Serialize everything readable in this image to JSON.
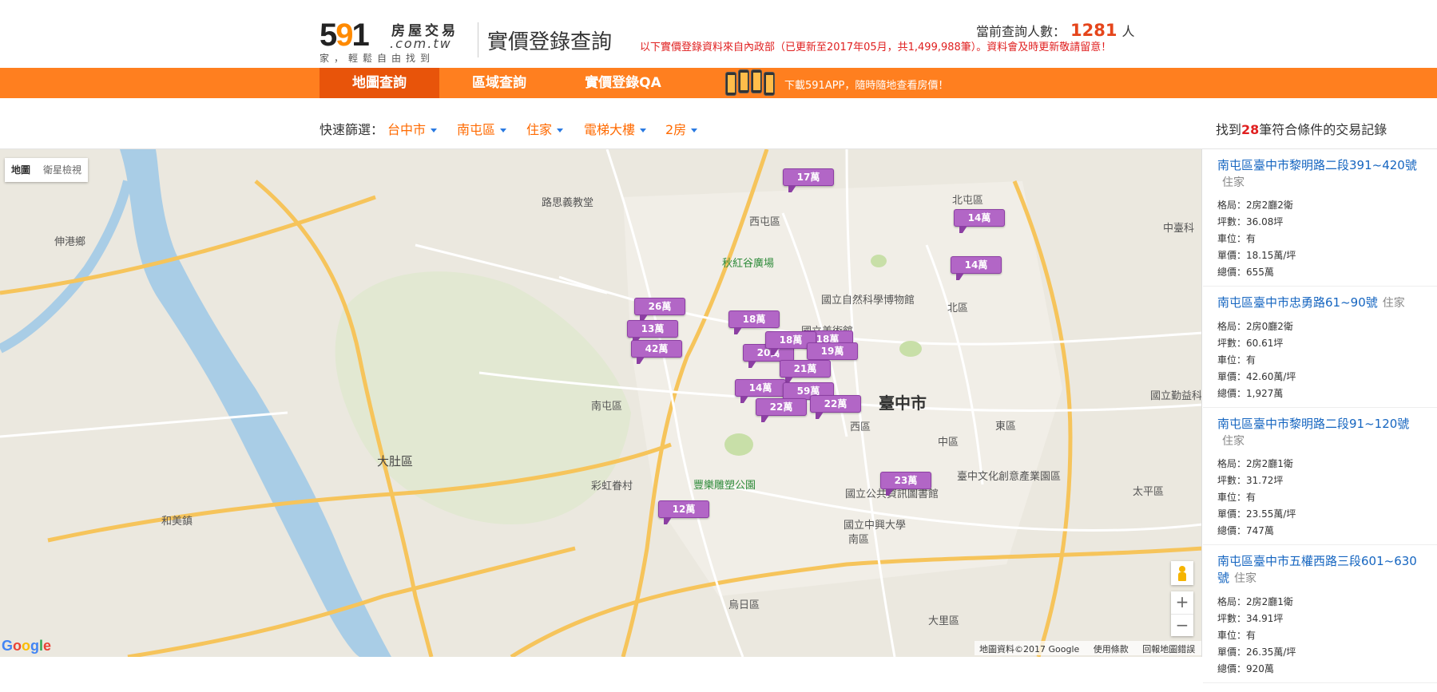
{
  "header": {
    "logo_digits_a": "5",
    "logo_digits_b": "9",
    "logo_digits_c": "1",
    "logo_cn": "房屋交易",
    "logo_domain": ".com.tw",
    "logo_slogan": "家，輕鬆自由找到",
    "site_title": "實價登錄查詢",
    "visitors_label": "當前查詢人數：",
    "visitors_count": "1281",
    "visitors_unit": "人",
    "notice": "以下實價登錄資料來自內政部（已更新至2017年05月，共1,499,988筆）。資料會及時更新敬請留意！"
  },
  "nav": {
    "items": [
      {
        "label": "地圖查詢",
        "active": true
      },
      {
        "label": "區域查詢",
        "active": false
      },
      {
        "label": "實價登錄QA",
        "active": false
      }
    ],
    "promo": "下載591APP，隨時隨地查看房價！"
  },
  "filters": {
    "label": "快速篩選：",
    "city": "台中市",
    "district": "南屯區",
    "usage": "住家",
    "building": "電梯大樓",
    "rooms": "2房",
    "result_prefix": "找到",
    "result_count": "28",
    "result_suffix": "筆符合條件的交易記錄"
  },
  "map": {
    "type_map": "地圖",
    "type_satellite": "衛星檢視",
    "google": "Google",
    "attribution": {
      "data": "地圖資料©2017 Google",
      "terms": "使用條款",
      "report": "回報地圖錯誤"
    },
    "zoom_in": "+",
    "zoom_out": "−",
    "labels": {
      "taichung": "臺中市",
      "dadu": "大肚區",
      "nantun": "南屯區",
      "xitun": "西屯區",
      "beitun": "北屯區",
      "north": "北區",
      "west": "西區",
      "central": "中區",
      "east": "東區",
      "south": "南區",
      "wuri": "烏日區",
      "dali": "大里區",
      "taiping": "太平區",
      "shengang": "伸港鄉",
      "hemei": "和美鎮",
      "luce_chapel": "路思義教堂",
      "qiuhong_park": "秋紅谷廣場",
      "science_museum": "國立自然科學博物館",
      "fine_arts": "國立美術館",
      "fengle_park": "豐樂雕塑公園",
      "caihong_village": "彩虹眷村",
      "public_library": "國立公共資訊圖書館",
      "chunghsing_univ": "國立中興大學",
      "cultural_park": "臺中文化創意產業園區",
      "qinyi_univ": "國立勤益科技大學",
      "zhongshe": "中臺科"
    },
    "pins": [
      "17萬",
      "14萬",
      "14萬",
      "26萬",
      "13萬",
      "42萬",
      "18萬",
      "18萬",
      "20萬",
      "18萬",
      "19萬",
      "21萬",
      "14萬",
      "59萬",
      "22萬",
      "22萬",
      "23萬",
      "12萬"
    ]
  },
  "listings": [
    {
      "title": "南屯區臺中市黎明路二段391~420號",
      "type": "住家",
      "layout": "格局：2房2廳2衛",
      "area": "坪數：36.08坪",
      "parking": "車位：有",
      "unit_price": "單價：18.15萬/坪",
      "total": "總價：655萬"
    },
    {
      "title": "南屯區臺中市忠勇路61~90號",
      "type": "住家",
      "layout": "格局：2房0廳2衛",
      "area": "坪數：60.61坪",
      "parking": "車位：有",
      "unit_price": "單價：42.60萬/坪",
      "total": "總價：1,927萬"
    },
    {
      "title": "南屯區臺中市黎明路二段91~120號",
      "type": "住家",
      "layout": "格局：2房2廳1衛",
      "area": "坪數：31.72坪",
      "parking": "車位：有",
      "unit_price": "單價：23.55萬/坪",
      "total": "總價：747萬"
    },
    {
      "title": "南屯區臺中市五權西路三段601~630號",
      "type": "住家",
      "layout": "格局：2房2廳1衛",
      "area": "坪數：34.91坪",
      "parking": "車位：有",
      "unit_price": "單價：26.35萬/坪",
      "total": "總價：920萬"
    }
  ],
  "colors": {
    "brand_orange": "#ff7f1f",
    "nav_active": "#e8540a",
    "pin_purple": "#b266c6",
    "link_blue": "#1565c0",
    "alert_red": "#e02020"
  }
}
